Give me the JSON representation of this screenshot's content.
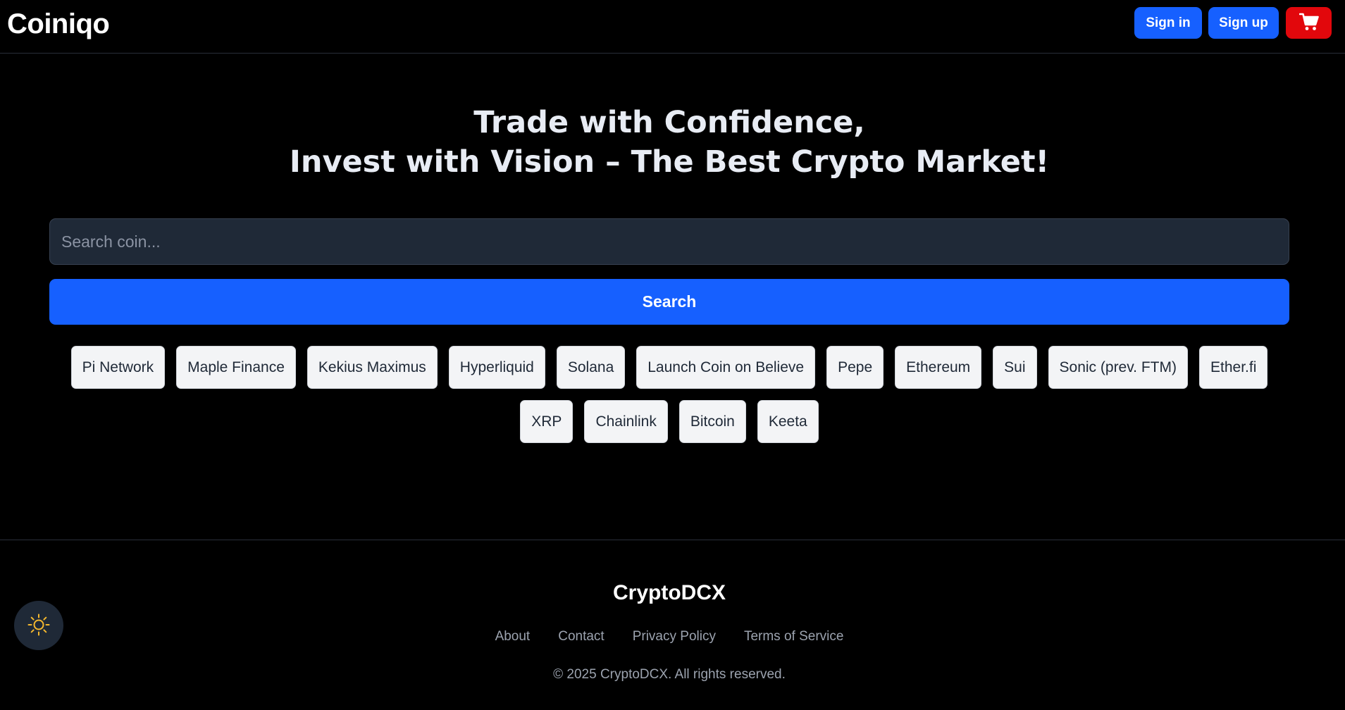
{
  "header": {
    "logo": "Coiniqo",
    "sign_in_label": "Sign in",
    "sign_up_label": "Sign up",
    "cart_icon": "shopping-cart-icon"
  },
  "hero": {
    "line1": "Trade with Confidence,",
    "line2": "Invest with Vision – The Best Crypto Market!"
  },
  "search": {
    "value": "",
    "placeholder": "Search coin...",
    "button_label": "Search"
  },
  "coins": [
    "Pi Network",
    "Maple Finance",
    "Kekius Maximus",
    "Hyperliquid",
    "Solana",
    "Launch Coin on Believe",
    "Pepe",
    "Ethereum",
    "Sui",
    "Sonic (prev. FTM)",
    "Ether.fi",
    "XRP",
    "Chainlink",
    "Bitcoin",
    "Keeta"
  ],
  "footer": {
    "brand": "CryptoDCX",
    "links": [
      "About",
      "Contact",
      "Privacy Policy",
      "Terms of Service"
    ],
    "copyright": "© 2025 CryptoDCX. All rights reserved."
  },
  "theme_toggle": {
    "icon": "sun-icon"
  },
  "colors": {
    "background": "#000000",
    "primary": "#1660ff",
    "cart": "#e2070c",
    "input_bg": "#1f2937",
    "chip_bg": "#f3f4f6",
    "sun": "#f5b82e"
  }
}
